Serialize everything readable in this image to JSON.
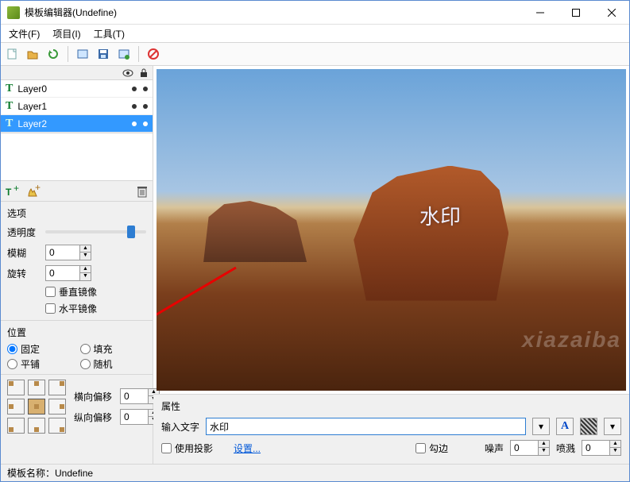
{
  "window": {
    "title": "模板编辑器(Undefine)"
  },
  "menu": {
    "file": "文件(F)",
    "project": "项目(I)",
    "tools": "工具(T)"
  },
  "layers": {
    "items": [
      {
        "name": "Layer0",
        "selected": false
      },
      {
        "name": "Layer1",
        "selected": false
      },
      {
        "name": "Layer2",
        "selected": true
      }
    ]
  },
  "options": {
    "title": "选项",
    "opacity_label": "透明度",
    "blur_label": "模糊",
    "blur_value": "0",
    "rotate_label": "旋转",
    "rotate_value": "0",
    "mirror_v": "垂直镜像",
    "mirror_h": "水平镜像"
  },
  "position": {
    "title": "位置",
    "fixed": "固定",
    "fill": "填充",
    "tile": "平铺",
    "random": "随机",
    "offset_h_label": "横向偏移",
    "offset_h_value": "0",
    "offset_v_label": "纵向偏移",
    "offset_v_value": "0"
  },
  "canvas": {
    "watermark_text": "水印"
  },
  "props": {
    "title": "属性",
    "input_label": "输入文字",
    "input_value": "水印",
    "use_shadow": "使用投影",
    "settings_link": "设置...",
    "stroke": "勾边",
    "noise_label": "噪声",
    "noise_value": "0",
    "spray_label": "喷溅",
    "spray_value": "0"
  },
  "status": {
    "label": "模板名称：",
    "value": "Undefine"
  },
  "watermark_site": "xiazaiba"
}
